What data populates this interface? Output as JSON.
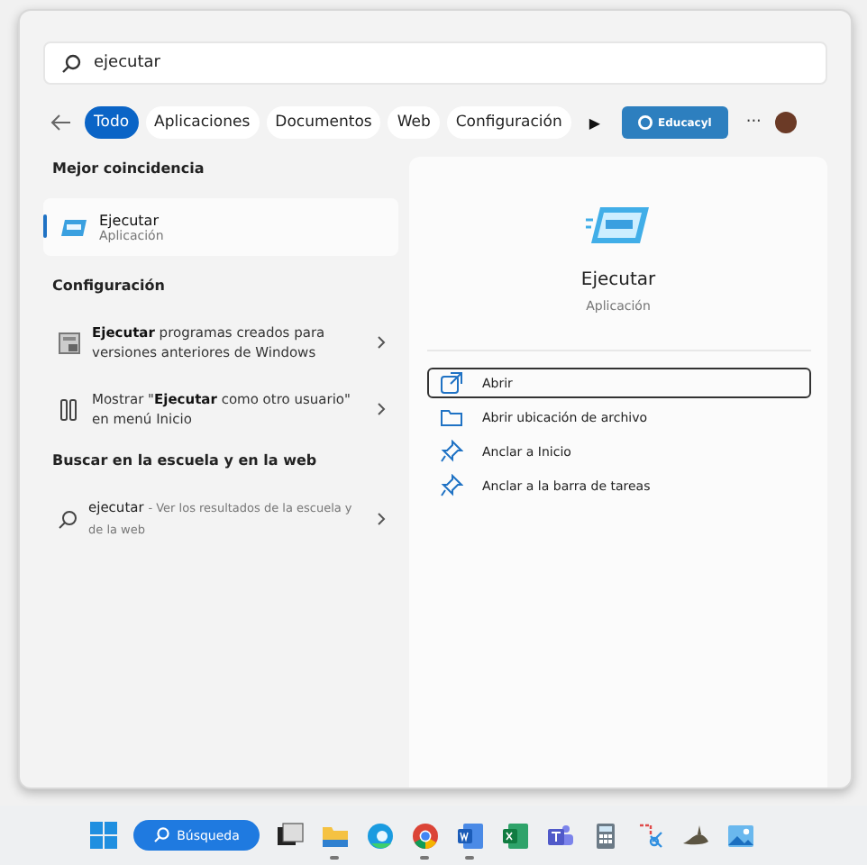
{
  "search": {
    "value": "ejecutar"
  },
  "filters": [
    {
      "label": "Todo",
      "selected": true
    },
    {
      "label": "Aplicaciones",
      "selected": false
    },
    {
      "label": "Documentos",
      "selected": false
    },
    {
      "label": "Web",
      "selected": false
    },
    {
      "label": "Configuración",
      "selected": false
    }
  ],
  "more_filters": "▶",
  "org_button": "Educacyl",
  "more": "···",
  "best_match": {
    "heading": "Mejor coincidencia",
    "title": "Ejecutar",
    "subtitle": "Aplicación",
    "selected": true
  },
  "settings": {
    "heading": "Configuración",
    "items": [
      {
        "kind": "legacy",
        "text": "**Ejecutar** programas creados para versiones anteriores de Windows"
      },
      {
        "kind": "user",
        "text": "Mostrar \"**Ejecutar** como otro usuario\" en menú Inicio"
      }
    ]
  },
  "web": {
    "heading": "Buscar en la escuela y en la web",
    "query": "ejecutar",
    "hint": "- Ver los resultados de la escuela y de la web"
  },
  "detail": {
    "title": "Ejecutar",
    "subtitle": "Aplicación",
    "actions": [
      {
        "kind": "open",
        "label": "Abrir",
        "selected": true
      },
      {
        "kind": "folder",
        "label": "Abrir ubicación de archivo",
        "selected": false
      },
      {
        "kind": "pin",
        "label": "Anclar a Inicio",
        "selected": false
      },
      {
        "kind": "pin",
        "label": "Anclar a la barra de tareas",
        "selected": false
      }
    ]
  },
  "taskbar": {
    "search_label": "Búsqueda",
    "apps": [
      {
        "kind": "desktop",
        "running": false
      },
      {
        "kind": "folder",
        "running": true
      },
      {
        "kind": "edge",
        "running": false
      },
      {
        "kind": "chrome",
        "running": true
      },
      {
        "kind": "word",
        "running": true
      },
      {
        "kind": "excel",
        "running": false
      },
      {
        "kind": "teams",
        "running": false
      },
      {
        "kind": "calculator",
        "running": false
      },
      {
        "kind": "snip",
        "running": false
      },
      {
        "kind": "gimp",
        "running": false
      },
      {
        "kind": "photos",
        "running": false
      }
    ]
  }
}
